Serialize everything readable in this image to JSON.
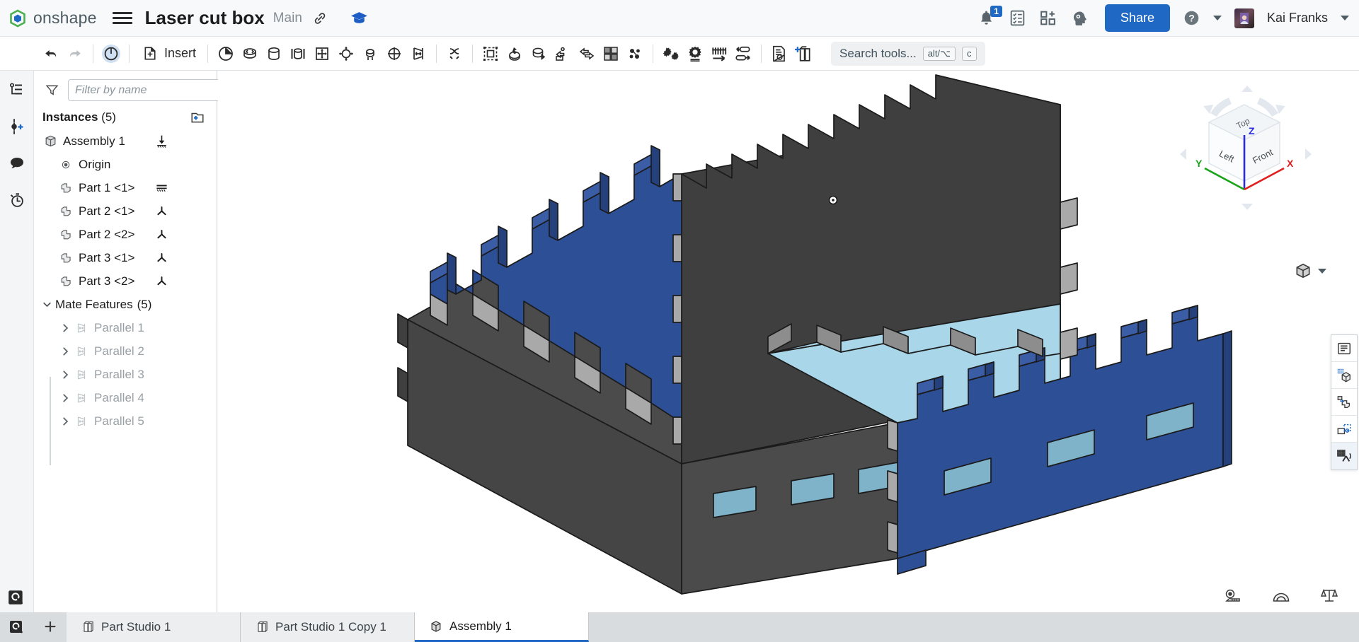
{
  "header": {
    "logo_text": "onshape",
    "logo_icon": "onshape-logo-icon",
    "menu_icon": "hamburger-menu-icon",
    "doc_title": "Laser cut box",
    "branch": "Main",
    "link_icon": "link-icon",
    "learning_icon": "graduation-cap-icon",
    "notifications": {
      "icon": "bell-icon",
      "badge": "1"
    },
    "tasks_icon": "tasks-list-icon",
    "apps_icon": "app-grid-add-icon",
    "settings_icon": "gear-head-icon",
    "share_label": "Share",
    "help_icon": "help-question-icon",
    "user_name": "Kai Franks",
    "avatar_icon": "user-avatar"
  },
  "toolbar": {
    "undo_icon": "undo-arrow-icon",
    "redo_icon": "redo-arrow-icon",
    "assembly_icon": "assembly-target-icon",
    "insert_label": "Insert",
    "insert_icon": "insert-part-icon",
    "items": [
      {
        "name": "fix-icon"
      },
      {
        "name": "revolute-mate-icon"
      },
      {
        "name": "slider-mate-icon"
      },
      {
        "name": "cylindrical-mate-icon"
      },
      {
        "name": "planar-mate-icon"
      },
      {
        "name": "ball-mate-icon"
      },
      {
        "name": "pin-slot-mate-icon"
      },
      {
        "name": "parallel-mate-icon"
      },
      {
        "name": "tangent-mate-icon"
      },
      {
        "name": "mate-connector-icon"
      },
      {
        "name": "group-icon"
      },
      {
        "name": "fasten-mate-icon"
      },
      {
        "name": "revolve-mate-icon"
      },
      {
        "name": "replicate-icon"
      },
      {
        "name": "linear-pattern-icon"
      },
      {
        "name": "explode-icon"
      },
      {
        "name": "gear-relation-icon"
      },
      {
        "name": "mate-connector-gear-icon"
      },
      {
        "name": "belt-relation-icon"
      },
      {
        "name": "screw-relation-icon"
      },
      {
        "name": "transform-icon"
      },
      {
        "name": "bill-of-materials-icon"
      },
      {
        "name": "drawing-add-icon"
      }
    ],
    "search_placeholder": "Search tools...",
    "search_kbd_1": "alt/⌥",
    "search_kbd_2": "c"
  },
  "left_rail": {
    "items": [
      {
        "name": "feature-tree-icon"
      },
      {
        "name": "add-version-icon"
      },
      {
        "name": "comments-icon"
      },
      {
        "name": "history-icon"
      }
    ],
    "bottom": {
      "name": "document-search-icon"
    }
  },
  "sidebar": {
    "filter_icon": "funnel-filter-icon",
    "filter_placeholder": "Filter by name",
    "list_options_icon": "list-options-icon",
    "instances_label": "Instances",
    "instances_count": "(5)",
    "add_instance_icon": "add-folder-icon",
    "nodes": [
      {
        "label": "Assembly 1",
        "icon": "assembly-cube-icon",
        "glyph": "fixed-ground-icon",
        "indent": 0,
        "muted": false
      },
      {
        "label": "Origin",
        "icon": "origin-point-icon",
        "glyph": "",
        "indent": 1,
        "muted": false
      },
      {
        "label": "Part 1 <1>",
        "icon": "part-icon",
        "glyph": "ground-hatch-icon",
        "indent": 1,
        "muted": false
      },
      {
        "label": "Part 2 <1>",
        "icon": "part-icon",
        "glyph": "mate-tripod-icon",
        "indent": 1,
        "muted": false
      },
      {
        "label": "Part 2 <2>",
        "icon": "part-icon",
        "glyph": "mate-tripod-icon",
        "indent": 1,
        "muted": false
      },
      {
        "label": "Part 3 <1>",
        "icon": "part-icon",
        "glyph": "mate-tripod-icon",
        "indent": 1,
        "muted": false
      },
      {
        "label": "Part 3 <2>",
        "icon": "part-icon",
        "glyph": "mate-tripod-icon",
        "indent": 1,
        "muted": false
      }
    ],
    "mate_features_label": "Mate Features",
    "mate_features_count": "(5)",
    "mate_collapse_icon": "chevron-down-icon",
    "mates": [
      {
        "label": "Parallel 1",
        "icon": "parallel-mate-icon",
        "chevron": "chevron-right-icon"
      },
      {
        "label": "Parallel 2",
        "icon": "parallel-mate-icon",
        "chevron": "chevron-right-icon"
      },
      {
        "label": "Parallel 3",
        "icon": "parallel-mate-icon",
        "chevron": "chevron-right-icon"
      },
      {
        "label": "Parallel 4",
        "icon": "parallel-mate-icon",
        "chevron": "chevron-right-icon"
      },
      {
        "label": "Parallel 5",
        "icon": "parallel-mate-icon",
        "chevron": "chevron-right-icon"
      }
    ],
    "panel_handle_icon": "panel-list-handle-icon"
  },
  "viewport": {
    "model_name": "laser-cut-box-assembly",
    "colors": {
      "blue_face": "#2d4f96",
      "blue_top": "#3a5da6",
      "blue_dark": "#24407d",
      "gray_face": "#4b4b4b",
      "gray_dark": "#3f3f3f",
      "gray_light": "#a9a9a9",
      "gray_mid": "#8d8d8d",
      "light_blue": "#a9d6e9",
      "light_blue_dim": "#7fb3c9",
      "edge": "#1b1b1b"
    },
    "viewcube": {
      "face_top": "Top",
      "face_left": "Left",
      "face_front": "Front",
      "axis_x": "X",
      "axis_y": "Y",
      "axis_z": "Z",
      "axis_x_color": "#e02020",
      "axis_y_color": "#19a319",
      "axis_z_color": "#2a2ae0",
      "menu_icon": "view-cube-menu-icon",
      "caret_icon": "chevron-down-icon"
    },
    "right_tools": [
      {
        "name": "display-states-icon",
        "active": false
      },
      {
        "name": "section-view-icon",
        "active": false
      },
      {
        "name": "exploded-view-icon",
        "active": false
      },
      {
        "name": "mate-display-icon",
        "active": false
      },
      {
        "name": "assembly-pattern-icon",
        "active": true
      }
    ],
    "measure_tools": [
      {
        "name": "measure-tape-icon"
      },
      {
        "name": "protractor-angle-icon"
      },
      {
        "name": "mass-properties-scale-icon"
      }
    ]
  },
  "tabbar": {
    "search_icon": "tab-search-icon",
    "add_label": "+",
    "tabs": [
      {
        "label": "Part Studio 1",
        "icon": "part-studio-icon",
        "active": false
      },
      {
        "label": "Part Studio 1 Copy 1",
        "icon": "part-studio-icon",
        "active": false
      },
      {
        "label": "Assembly 1",
        "icon": "assembly-cube-icon",
        "active": true
      }
    ]
  }
}
